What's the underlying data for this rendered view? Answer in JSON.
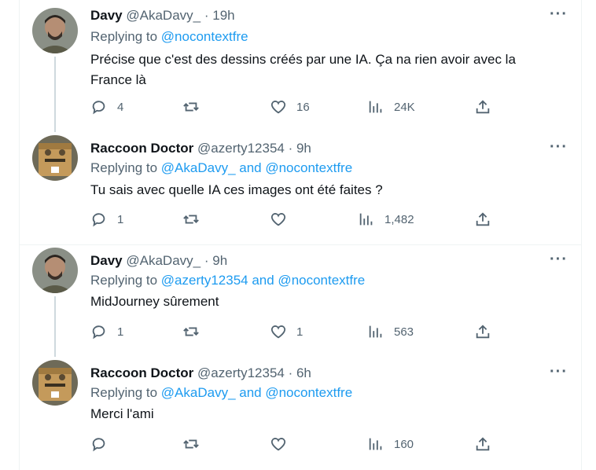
{
  "colors": {
    "link": "#1d9bf0",
    "secondary": "#536471",
    "text": "#0f1419"
  },
  "tweets": [
    {
      "name": "Davy",
      "handle": "@AkaDavy_",
      "time": "· 19h",
      "reply_prefix": "Replying to",
      "reply_targets": "@nocontextfre",
      "text": "Précise que c'est des dessins créés par une IA. Ça na rien avoir avec  la France là",
      "counts": {
        "replies": "4",
        "retweets": "",
        "likes": "16",
        "views": "24K"
      }
    },
    {
      "name": "Raccoon Doctor",
      "handle": "@azerty12354",
      "time": "· 9h",
      "reply_prefix": "Replying to",
      "reply_targets": "@AkaDavy_ and @nocontextfre",
      "text": "Tu sais avec quelle IA ces images ont été faites ?",
      "counts": {
        "replies": "1",
        "retweets": "",
        "likes": "",
        "views": "1,482"
      }
    },
    {
      "name": "Davy",
      "handle": "@AkaDavy_",
      "time": "· 9h",
      "reply_prefix": "Replying to",
      "reply_targets": "@azerty12354 and @nocontextfre",
      "text": "MidJourney sûrement",
      "counts": {
        "replies": "1",
        "retweets": "",
        "likes": "1",
        "views": "563"
      }
    },
    {
      "name": "Raccoon Doctor",
      "handle": "@azerty12354",
      "time": "· 6h",
      "reply_prefix": "Replying to",
      "reply_targets": "@AkaDavy_ and @nocontextfre",
      "text": "Merci l'ami",
      "counts": {
        "replies": "",
        "retweets": "",
        "likes": "",
        "views": "160"
      }
    }
  ],
  "icons": [
    "more-icon",
    "reply-icon",
    "retweet-icon",
    "like-icon",
    "views-icon",
    "share-icon"
  ]
}
